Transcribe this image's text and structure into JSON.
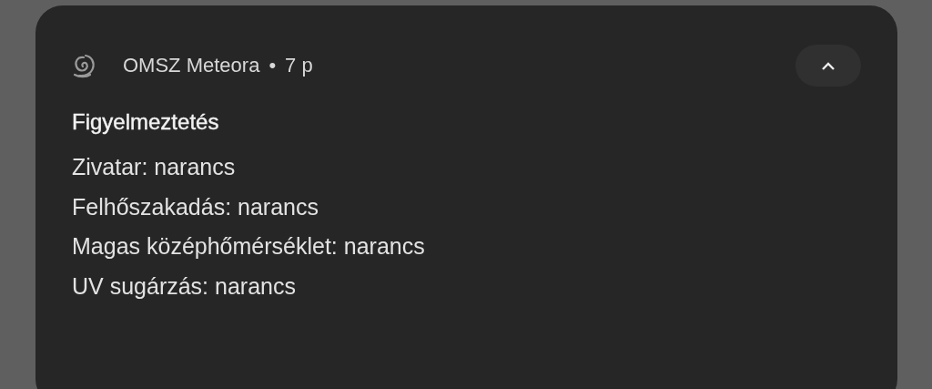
{
  "notification": {
    "app_name": "OMSZ Meteora",
    "separator": "•",
    "time": "7 p",
    "expanded": true,
    "title": "Figyelmeztetés",
    "lines": [
      "Zivatar: narancs",
      "Felhőszakadás: narancs",
      "Magas középhőmérséklet: narancs",
      "UV sugárzás: narancs"
    ]
  }
}
